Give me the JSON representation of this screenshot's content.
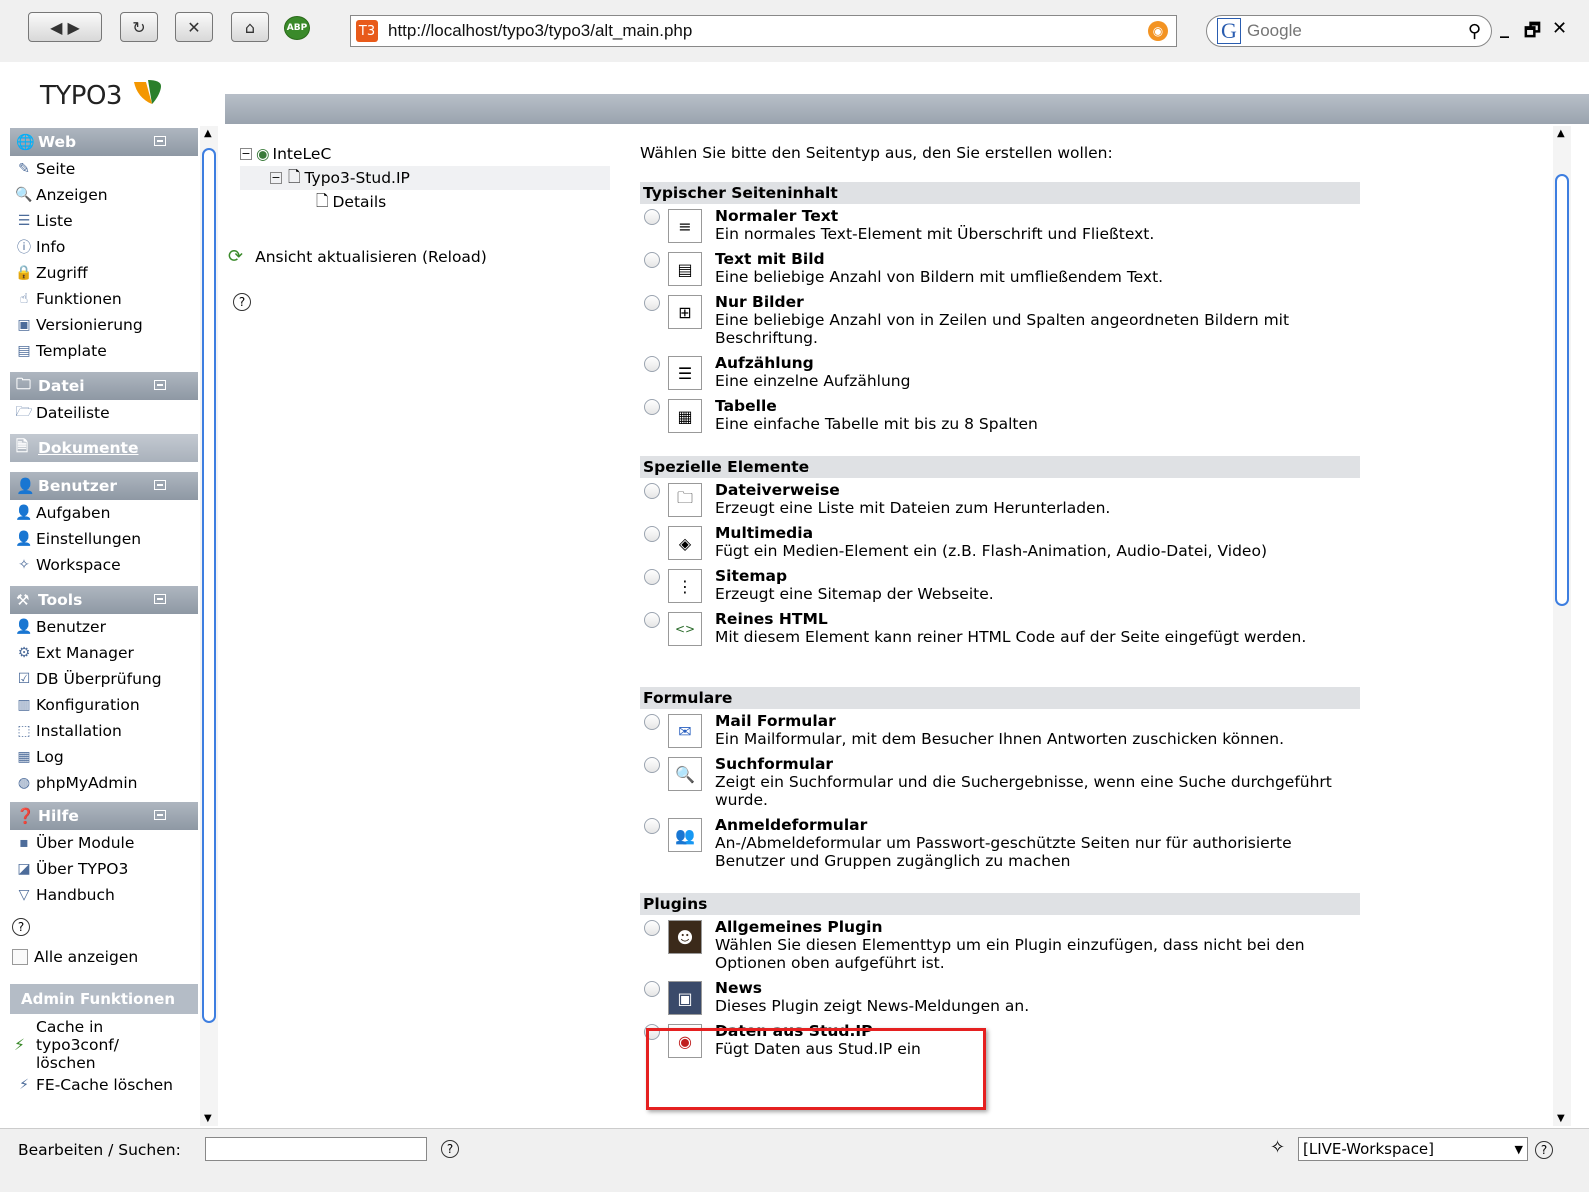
{
  "browser": {
    "url": "http://localhost/typo3/typo3/alt_main.php",
    "search_placeholder": "Google",
    "favicon": "T3",
    "search_engine_letter": "G",
    "controls": {
      "back": "◀",
      "forward": "▶",
      "reload": "↻",
      "stop": "✕",
      "home": "⌂",
      "abp": "ABP",
      "minimize": "_",
      "restore": "🗗",
      "close": "✕"
    }
  },
  "logo": "TYPO3",
  "nav": {
    "web": {
      "title": "Web",
      "items": [
        "Seite",
        "Anzeigen",
        "Liste",
        "Info",
        "Zugriff",
        "Funktionen",
        "Versionierung",
        "Template"
      ]
    },
    "datei": {
      "title": "Datei",
      "items": [
        "Dateiliste"
      ]
    },
    "dokumente": "Dokumente",
    "benutzer": {
      "title": "Benutzer",
      "items": [
        "Aufgaben",
        "Einstellungen",
        "Workspace"
      ]
    },
    "tools": {
      "title": "Tools",
      "items": [
        "Benutzer",
        "Ext Manager",
        "DB Überprüfung",
        "Konfiguration",
        "Installation",
        "Log",
        "phpMyAdmin"
      ]
    },
    "hilfe": {
      "title": "Hilfe",
      "items": [
        "Über Module",
        "Über TYPO3",
        "Handbuch"
      ]
    },
    "show_all": "Alle anzeigen",
    "admin": {
      "title": "Admin Funktionen",
      "cache": "Cache in typo3conf/ löschen",
      "fe_cache": "FE-Cache löschen"
    }
  },
  "tree": {
    "root": "InteLeC",
    "child": "Typo3-Stud.IP",
    "grandchild": "Details",
    "reload": "Ansicht aktualisieren (Reload)"
  },
  "main": {
    "intro": "Wählen Sie bitte den Seitentyp aus, den Sie erstellen wollen:",
    "cats": [
      {
        "title": "Typischer Seiteninhalt",
        "items": [
          {
            "t": "Normaler Text",
            "d": "Ein normales Text-Element mit Überschrift und Fließtext."
          },
          {
            "t": "Text mit Bild",
            "d": "Eine beliebige Anzahl von Bildern mit umfließendem Text."
          },
          {
            "t": "Nur Bilder",
            "d": "Eine beliebige Anzahl von in Zeilen und Spalten angeordneten Bildern mit Beschriftung."
          },
          {
            "t": "Aufzählung",
            "d": "Eine einzelne Aufzählung"
          },
          {
            "t": "Tabelle",
            "d": "Eine einfache Tabelle mit bis zu 8 Spalten"
          }
        ]
      },
      {
        "title": "Spezielle Elemente",
        "items": [
          {
            "t": "Dateiverweise",
            "d": "Erzeugt eine Liste mit Dateien zum Herunterladen."
          },
          {
            "t": "Multimedia",
            "d": "Fügt ein Medien-Element ein (z.B. Flash-Animation, Audio-Datei, Video)"
          },
          {
            "t": "Sitemap",
            "d": "Erzeugt eine Sitemap der Webseite."
          },
          {
            "t": "Reines HTML",
            "d": "Mit diesem Element kann reiner HTML Code auf der Seite eingefügt werden."
          }
        ]
      },
      {
        "title": "Formulare",
        "items": [
          {
            "t": "Mail Formular",
            "d": "Ein Mailformular, mit dem Besucher Ihnen Antworten zuschicken können."
          },
          {
            "t": "Suchformular",
            "d": "Zeigt ein Suchformular und die Suchergebnisse, wenn eine Suche durchgeführt wurde."
          },
          {
            "t": "Anmeldeformular",
            "d": "An-/Abmeldeformular um Passwort-geschützte Seiten nur für authorisierte Benutzer und Gruppen zugänglich zu machen"
          }
        ]
      },
      {
        "title": "Plugins",
        "items": [
          {
            "t": "Allgemeines Plugin",
            "d": "Wählen Sie diesen Elementtyp um ein Plugin einzufügen, dass nicht bei den Optionen oben aufgeführt ist."
          },
          {
            "t": "News",
            "d": "Dieses Plugin zeigt News-Meldungen an."
          },
          {
            "t": "Daten aus Stud.IP",
            "d": "Fügt Daten aus Stud.IP ein"
          }
        ]
      }
    ]
  },
  "bottom": {
    "label": "Bearbeiten / Suchen:",
    "workspace": "[LIVE-Workspace]",
    "help": "?"
  }
}
